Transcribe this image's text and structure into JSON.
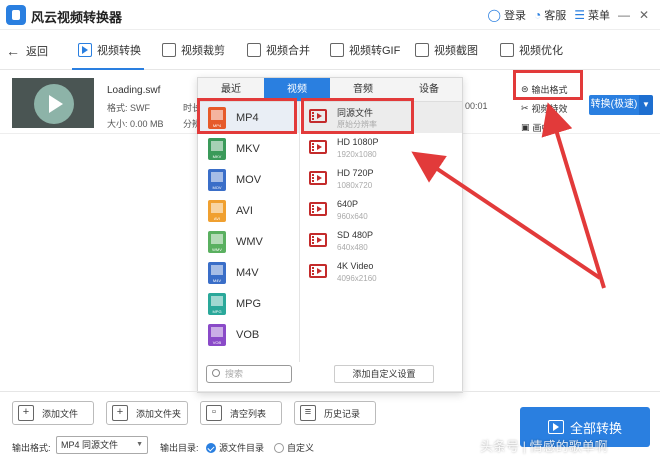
{
  "app": {
    "title": "风云视频转换器"
  },
  "titlebar": {
    "login": "登录",
    "service": "客服",
    "menu": "菜单",
    "minimize": "—",
    "close": "✕"
  },
  "nav": {
    "back": "返回",
    "tabs": [
      "视频转换",
      "视频裁剪",
      "视频合并",
      "视频转GIF",
      "视频截图",
      "视频优化"
    ]
  },
  "file": {
    "name": "Loading.swf",
    "format": "格式: SWF",
    "size": "大小: 0.00 MB",
    "duration_label": "时长",
    "resolution_label": "分辨",
    "time_value": "00:01",
    "convert_button": "转换(极速)",
    "output_format": "输出格式",
    "set_effect": "视频特效",
    "set_watermark": "画中画"
  },
  "dropdown": {
    "tabs": [
      "最近",
      "视频",
      "音频",
      "设备"
    ],
    "active_tab": 1,
    "formats": [
      {
        "label": "MP4",
        "color": "#e65a2a"
      },
      {
        "label": "MKV",
        "color": "#3a9a5a"
      },
      {
        "label": "MOV",
        "color": "#3a6ec8"
      },
      {
        "label": "AVI",
        "color": "#f0a030"
      },
      {
        "label": "WMV",
        "color": "#5ab060"
      },
      {
        "label": "M4V",
        "color": "#3a6ec8"
      },
      {
        "label": "MPG",
        "color": "#2aa89a"
      },
      {
        "label": "VOB",
        "color": "#8a4ac8"
      }
    ],
    "resolutions": [
      {
        "name": "同源文件",
        "sub": "原始分辨率"
      },
      {
        "name": "HD 1080P",
        "sub": "1920x1080"
      },
      {
        "name": "HD 720P",
        "sub": "1080x720"
      },
      {
        "name": "640P",
        "sub": "960x640"
      },
      {
        "name": "SD 480P",
        "sub": "640x480"
      },
      {
        "name": "4K Video",
        "sub": "4096x2160"
      }
    ],
    "search_placeholder": "搜索",
    "add_custom": "添加自定义设置"
  },
  "bottom": {
    "add_file": "添加文件",
    "add_folder": "添加文件夹",
    "clear_list": "清空列表",
    "history": "历史记录",
    "output_format_label": "输出格式:",
    "output_format_value": "MP4 同源文件",
    "output_dir_label": "输出目录:",
    "source_dir": "源文件目录",
    "custom_dir": "自定义",
    "convert_all": "全部转换"
  },
  "watermark": "头条号 | 情感的歌单啊",
  "colors": {
    "accent": "#2a7fe0",
    "highlight": "#e23a3a"
  }
}
